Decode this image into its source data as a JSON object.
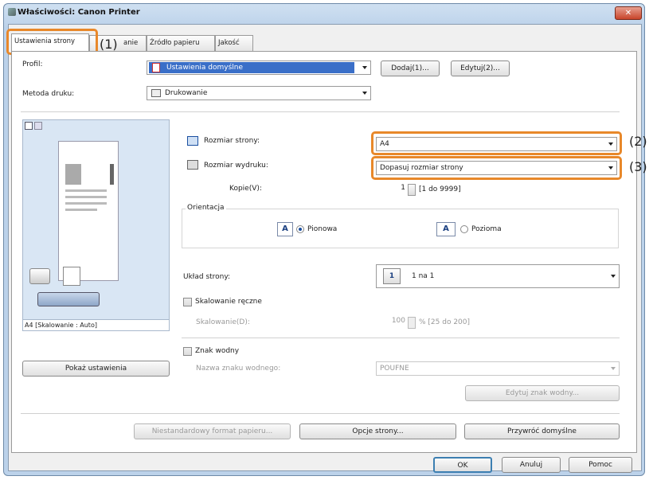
{
  "window": {
    "title": "Właściwości: Canon Printer",
    "close": "✕"
  },
  "tabs": [
    "Ustawienia strony",
    "Wykończenie",
    "Źródło papieru",
    "Jakość"
  ],
  "tab_partial": "anie",
  "callouts": {
    "c1": "(1)",
    "c2": "(2)",
    "c3": "(3)"
  },
  "profile": {
    "label": "Profil:",
    "value": "Ustawienia domyślne",
    "add": "Dodaj(1)...",
    "edit": "Edytuj(2)..."
  },
  "method": {
    "label": "Metoda druku:",
    "value": "Drukowanie"
  },
  "page_size": {
    "label": "Rozmiar strony:",
    "value": "A4"
  },
  "output_size": {
    "label": "Rozmiar wydruku:",
    "value": "Dopasuj rozmiar strony"
  },
  "copies": {
    "label": "Kopie(V):",
    "value": "1",
    "range": "[1 do 9999]"
  },
  "orientation": {
    "label": "Orientacja",
    "portrait": "Pionowa",
    "landscape": "Pozioma",
    "letter": "A"
  },
  "layout": {
    "label": "Układ strony:",
    "value": "1 na 1",
    "icon_num": "1"
  },
  "manual_scaling": {
    "label": "Skalowanie ręczne",
    "scaling_label": "Skalowanie(D):",
    "value": "100",
    "range": "% [25 do 200]"
  },
  "watermark": {
    "label": "Znak wodny",
    "name_label": "Nazwa znaku wodnego:",
    "value": "POUFNE",
    "edit": "Edytuj znak wodny..."
  },
  "preview": {
    "caption": "A4 [Skalowanie : Auto]",
    "show_settings": "Pokaż ustawienia"
  },
  "bottom_buttons": {
    "custom": "Niestandardowy format papieru...",
    "page_opts": "Opcje strony...",
    "restore": "Przywróć domyślne"
  },
  "dialog_buttons": {
    "ok": "OK",
    "cancel": "Anuluj",
    "help": "Pomoc"
  },
  "colors": {
    "highlight": "#e8882a",
    "selection": "#3a6fc8"
  }
}
